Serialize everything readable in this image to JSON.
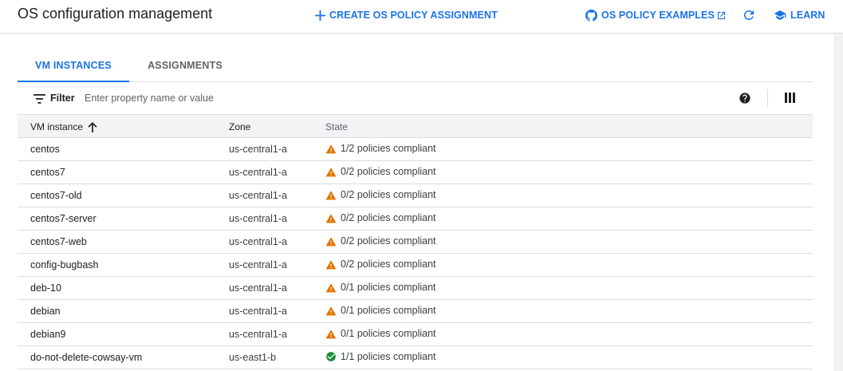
{
  "header": {
    "title": "OS configuration management",
    "create_label": "CREATE OS POLICY ASSIGNMENT",
    "examples_label": "OS POLICY EXAMPLES",
    "learn_label": "LEARN"
  },
  "tabs": [
    {
      "label": "VM INSTANCES",
      "active": true
    },
    {
      "label": "ASSIGNMENTS",
      "active": false
    }
  ],
  "filter": {
    "label": "Filter",
    "placeholder": "Enter property name or value"
  },
  "table": {
    "columns": [
      "VM instance",
      "Zone",
      "State"
    ],
    "sort_column": "VM instance",
    "sort_direction": "ascending",
    "rows": [
      {
        "name": "centos",
        "zone": "us-central1-a",
        "state": "1/2 policies compliant",
        "status": "warning"
      },
      {
        "name": "centos7",
        "zone": "us-central1-a",
        "state": "0/2 policies compliant",
        "status": "warning"
      },
      {
        "name": "centos7-old",
        "zone": "us-central1-a",
        "state": "0/2 policies compliant",
        "status": "warning"
      },
      {
        "name": "centos7-server",
        "zone": "us-central1-a",
        "state": "0/2 policies compliant",
        "status": "warning"
      },
      {
        "name": "centos7-web",
        "zone": "us-central1-a",
        "state": "0/2 policies compliant",
        "status": "warning"
      },
      {
        "name": "config-bugbash",
        "zone": "us-central1-a",
        "state": "0/2 policies compliant",
        "status": "warning"
      },
      {
        "name": "deb-10",
        "zone": "us-central1-a",
        "state": "0/1 policies compliant",
        "status": "warning"
      },
      {
        "name": "debian",
        "zone": "us-central1-a",
        "state": "0/1 policies compliant",
        "status": "warning"
      },
      {
        "name": "debian9",
        "zone": "us-central1-a",
        "state": "0/1 policies compliant",
        "status": "warning"
      },
      {
        "name": "do-not-delete-cowsay-vm",
        "zone": "us-east1-b",
        "state": "1/1 policies compliant",
        "status": "ok"
      }
    ]
  },
  "colors": {
    "accent": "#1a73e8",
    "warning": "#e37400",
    "ok": "#1e8e3e",
    "header_bg": "#f1f3f4"
  },
  "icons": {
    "create": "plus-icon",
    "examples": "github-icon",
    "external": "external-link-icon",
    "refresh": "refresh-icon",
    "learn": "graduation-cap-icon",
    "filter": "filter-icon",
    "help": "help-icon",
    "columns": "column-display-icon",
    "sort": "arrow-up-icon",
    "warning": "warning-icon",
    "ok": "check-circle-icon"
  }
}
